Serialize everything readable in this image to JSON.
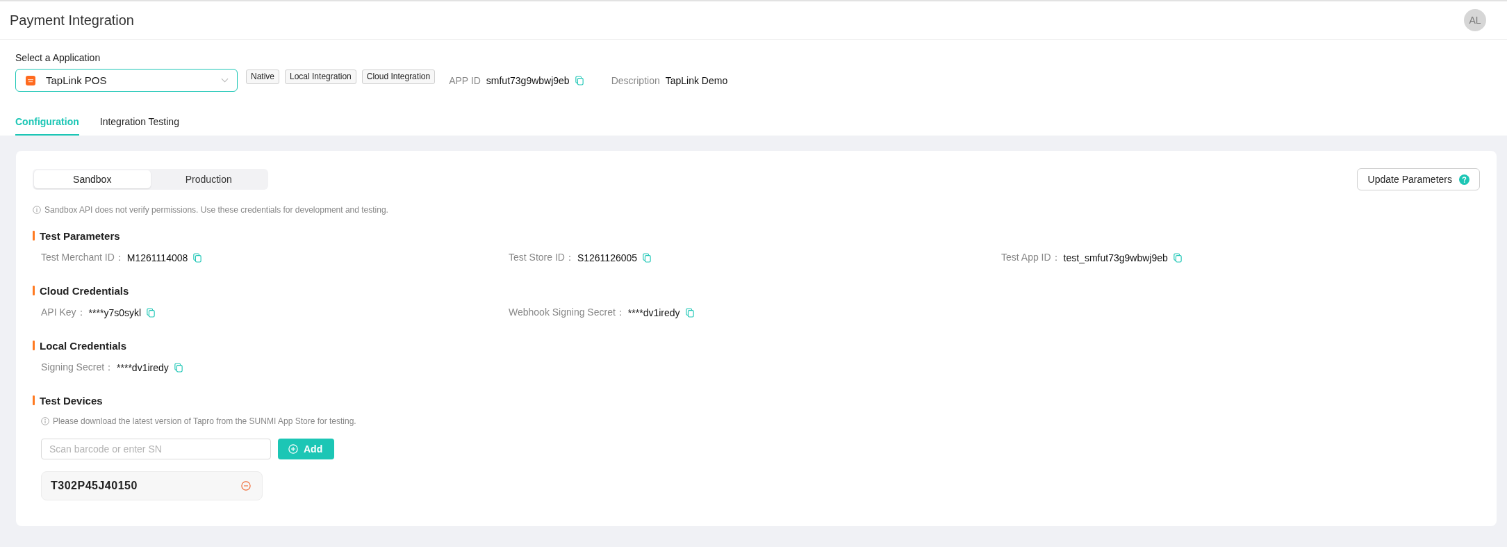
{
  "header": {
    "title": "Payment Integration",
    "avatar": "AL"
  },
  "app_selector": {
    "label": "Select a Application",
    "value": "TapLink POS",
    "tags": [
      "Native",
      "Local Integration",
      "Cloud Integration"
    ],
    "app_id": {
      "label": "APP ID",
      "value": "smfut73g9wbwj9eb"
    },
    "description": {
      "label": "Description",
      "value": "TapLink Demo"
    }
  },
  "tabs": [
    {
      "label": "Configuration",
      "selected": true
    },
    {
      "label": "Integration Testing",
      "selected": false
    }
  ],
  "environment": {
    "options": [
      {
        "label": "Sandbox",
        "selected": true
      },
      {
        "label": "Production",
        "selected": false
      }
    ],
    "update_button": "Update Parameters",
    "note": "Sandbox API does not verify permissions. Use these credentials for development and testing."
  },
  "sections": [
    {
      "title": "Test Parameters",
      "fields": [
        {
          "label": "Test Merchant ID：",
          "value": "M1261114008"
        },
        {
          "label": "Test Store ID：",
          "value": "S1261126005"
        },
        {
          "label": "Test App ID：",
          "value": "test_smfut73g9wbwj9eb"
        }
      ]
    },
    {
      "title": "Cloud Credentials",
      "fields": [
        {
          "label": "API Key：",
          "value": "****y7s0sykl"
        },
        {
          "label": "Webhook Signing Secret：",
          "value": "****dv1iredy"
        }
      ]
    },
    {
      "title": "Local Credentials",
      "fields": [
        {
          "label": "Signing Secret：",
          "value": "****dv1iredy"
        }
      ]
    }
  ],
  "test_devices": {
    "title": "Test Devices",
    "note": "Please download the latest version of Tapro from the SUNMI App Store for testing.",
    "input": {
      "placeholder": "Scan barcode or enter SN"
    },
    "add_button": "Add",
    "items": [
      "T302P45J40150"
    ]
  }
}
